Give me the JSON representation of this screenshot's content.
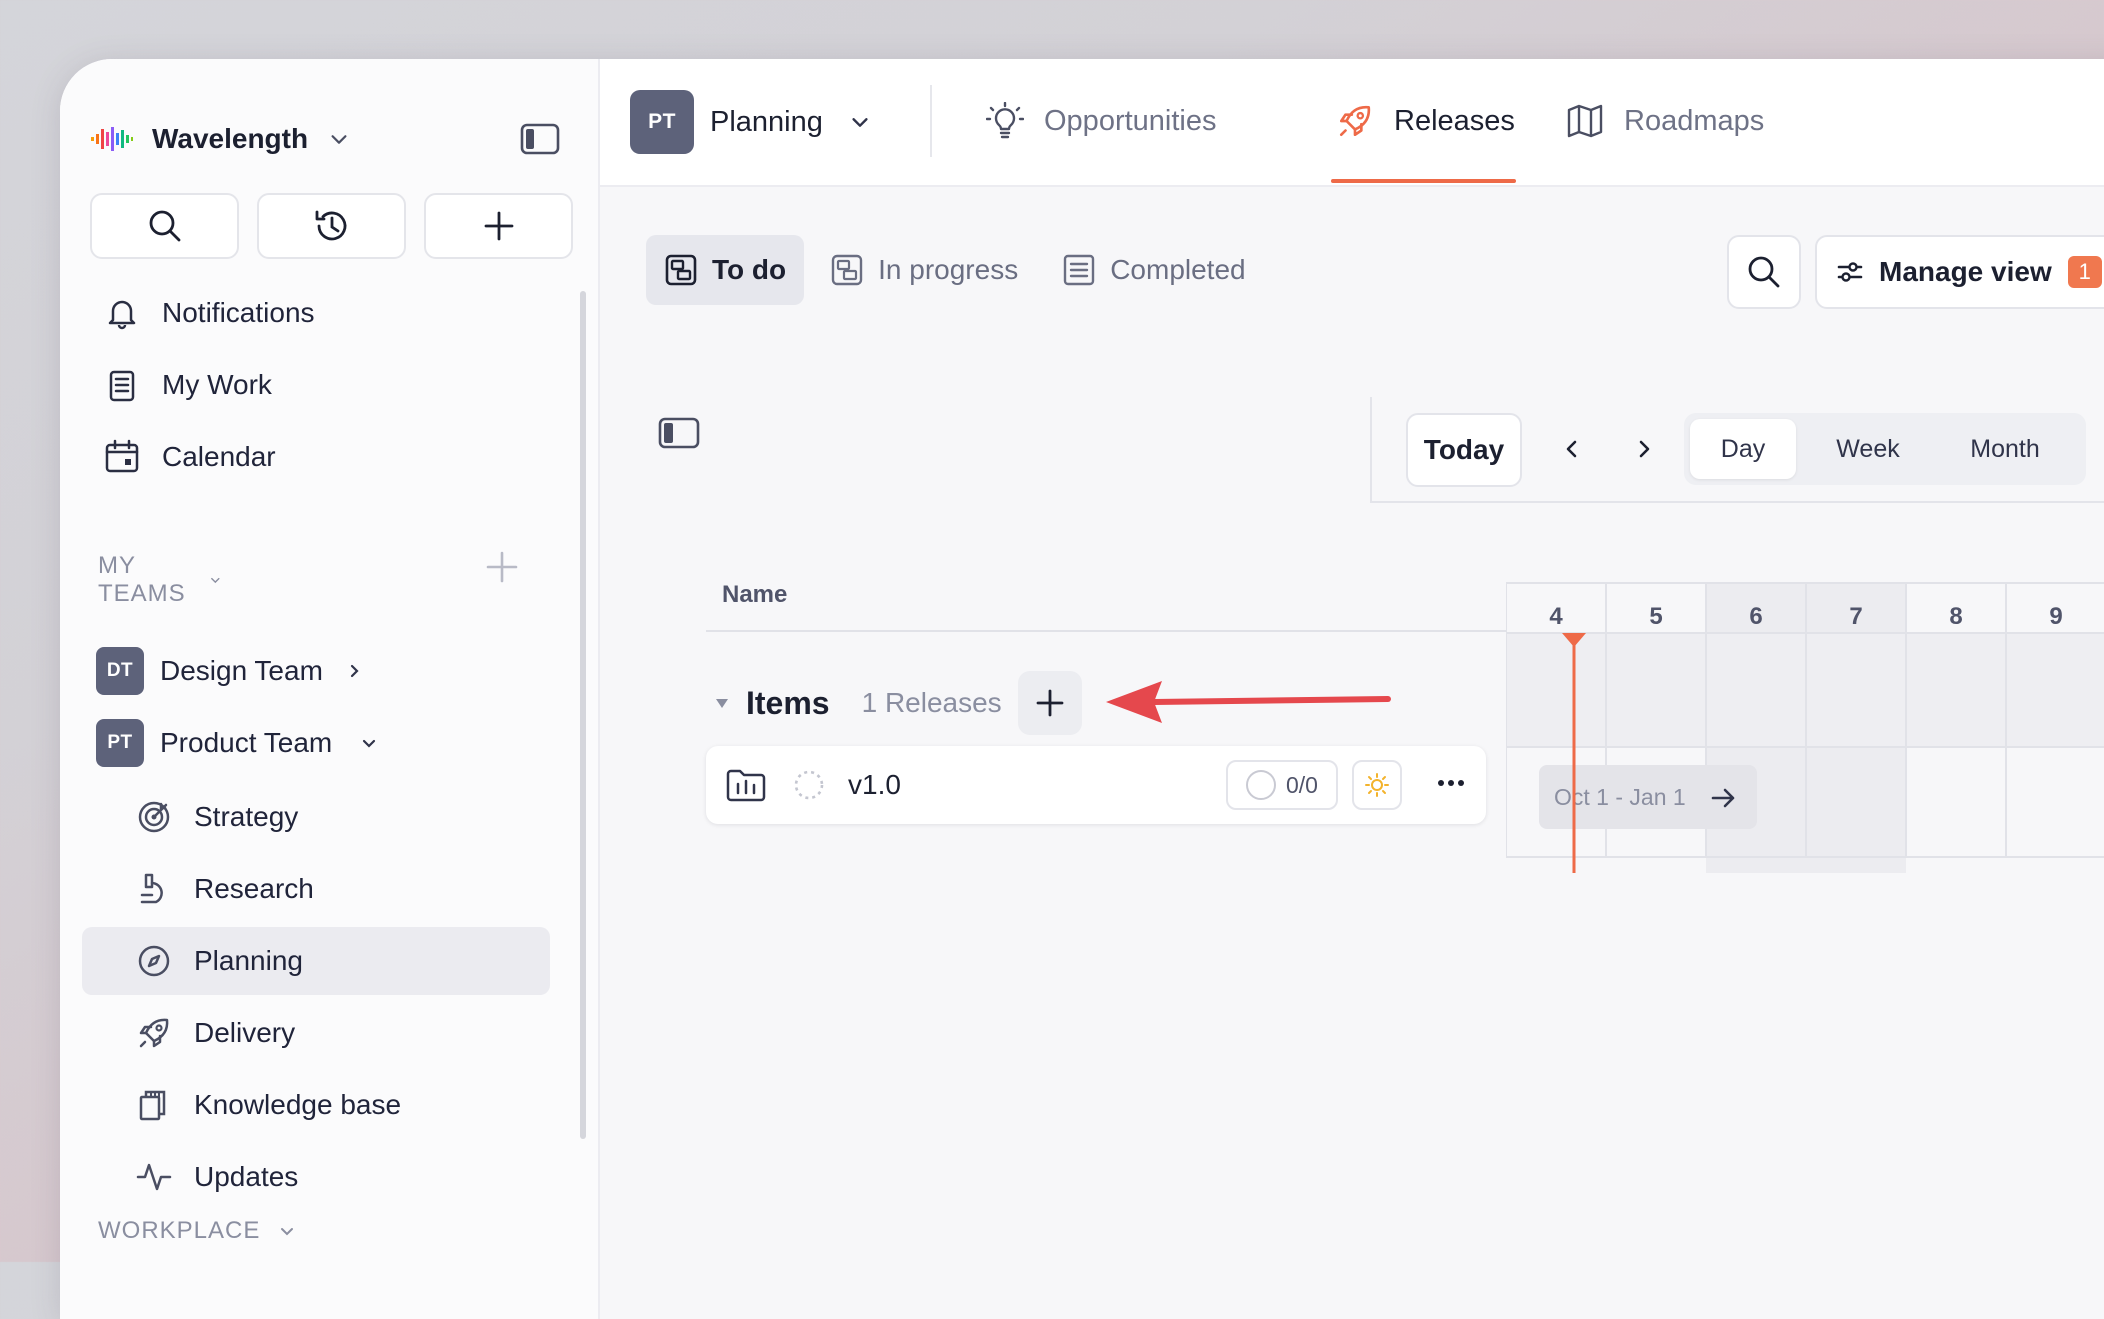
{
  "workspace": {
    "name": "Wavelength"
  },
  "sidebar": {
    "nav": [
      {
        "label": "Notifications",
        "icon": "bell-icon"
      },
      {
        "label": "My Work",
        "icon": "clipboard-list-icon"
      },
      {
        "label": "Calendar",
        "icon": "calendar-icon"
      }
    ],
    "my_teams_title": "MY TEAMS",
    "teams": [
      {
        "initials": "DT",
        "label": "Design Team",
        "expanded": false
      },
      {
        "initials": "PT",
        "label": "Product Team",
        "expanded": true
      }
    ],
    "team_items": [
      {
        "label": "Strategy",
        "icon": "target-icon"
      },
      {
        "label": "Research",
        "icon": "microscope-icon"
      },
      {
        "label": "Planning",
        "icon": "compass-icon",
        "active": true
      },
      {
        "label": "Delivery",
        "icon": "rocket-icon"
      },
      {
        "label": "Knowledge base",
        "icon": "copy-docs-icon"
      },
      {
        "label": "Updates",
        "icon": "activity-icon"
      }
    ],
    "workplace_title": "WORKPLACE"
  },
  "topbar": {
    "project_initials": "PT",
    "project_name": "Planning",
    "tabs": [
      {
        "label": "Opportunities",
        "icon": "lightbulb-icon"
      },
      {
        "label": "Releases",
        "icon": "rocket-icon",
        "active": true
      },
      {
        "label": "Roadmaps",
        "icon": "map-icon"
      }
    ],
    "accent": "#ee6a48"
  },
  "main": {
    "status_tabs": [
      {
        "label": "To do",
        "active": true
      },
      {
        "label": "In progress"
      },
      {
        "label": "Completed"
      }
    ],
    "manage_view_label": "Manage view",
    "manage_view_badge": "1",
    "timeline": {
      "today_label": "Today",
      "scales": [
        "Day",
        "Week",
        "Month"
      ],
      "active_scale": "Day",
      "days": [
        "4",
        "5",
        "6",
        "7",
        "8",
        "9"
      ],
      "weekend_days": [
        "6",
        "7"
      ],
      "today_day": "4"
    },
    "name_column": "Name",
    "group": {
      "title": "Items",
      "count_label": "1 Releases"
    },
    "release": {
      "version": "v1.0",
      "progress": "0/0",
      "date_range": "Oct 1 - Jan 1"
    }
  }
}
